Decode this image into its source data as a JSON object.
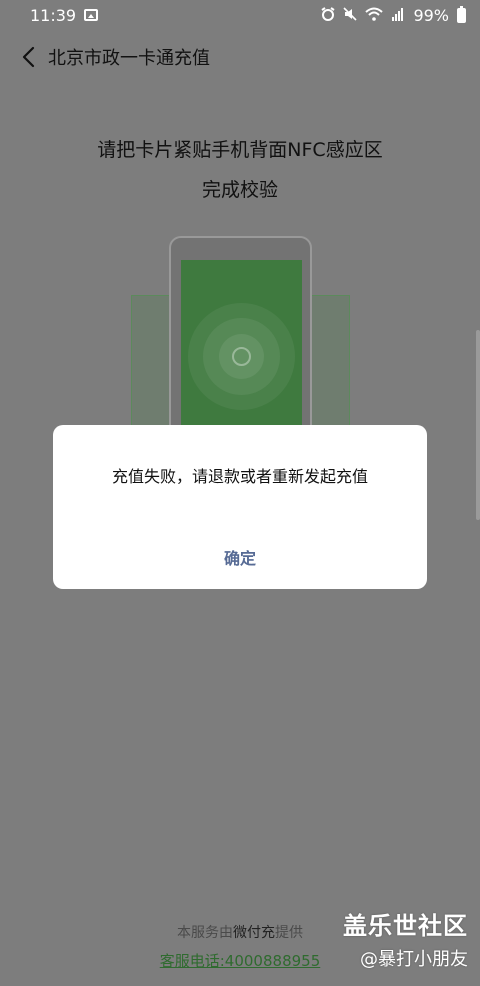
{
  "status_bar": {
    "time": "11:39",
    "battery": "99%",
    "icons": [
      "image-icon",
      "alarm-icon",
      "mute-icon",
      "wifi-icon",
      "signal-icon",
      "battery-icon"
    ]
  },
  "header": {
    "title": "北京市政一卡通充值"
  },
  "instruction": {
    "line1": "请把卡片紧贴手机背面NFC感应区",
    "line2": "完成校验"
  },
  "dialog": {
    "message": "充值失败，请退款或者重新发起充值",
    "confirm_label": "确定"
  },
  "footer": {
    "provider_prefix": "本服务由",
    "provider_brand": "微付充",
    "provider_suffix": "提供",
    "service_phone": "客服电话:4000888955"
  },
  "watermark": {
    "title": "盖乐世社区",
    "author": "@暴打小朋友"
  },
  "colors": {
    "overlay_bg": "#7d7d7d",
    "phone_screen_green": "#3f7a3f",
    "dialog_button": "#576b95",
    "link_green": "#2f6b2f"
  }
}
